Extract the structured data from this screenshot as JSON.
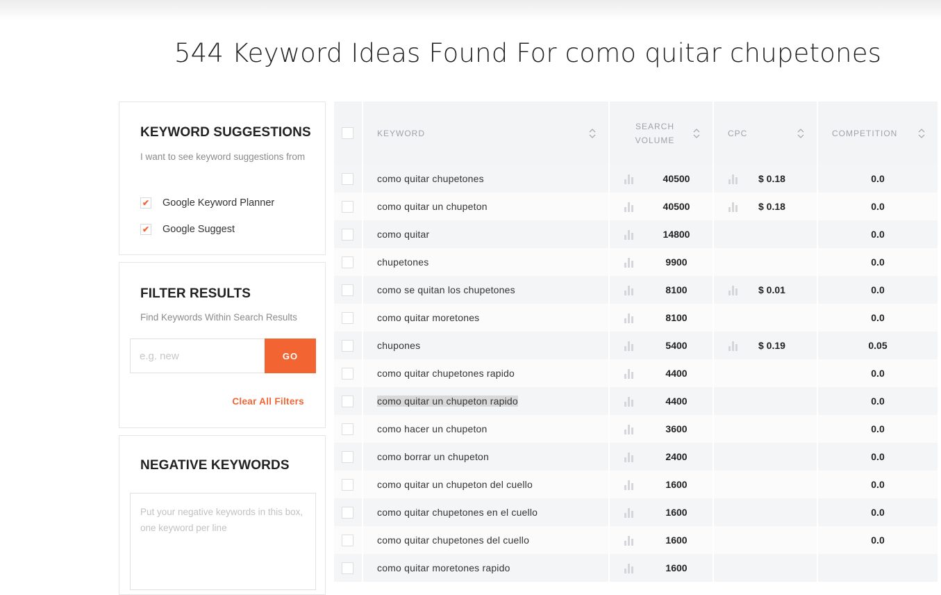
{
  "title": "544 Keyword Ideas Found For como quitar chupetones",
  "suggestions": {
    "heading": "KEYWORD SUGGESTIONS",
    "description": "I want to see keyword suggestions from",
    "options": [
      {
        "label": "Google Keyword Planner",
        "checked": true
      },
      {
        "label": "Google Suggest",
        "checked": true
      }
    ]
  },
  "filter": {
    "heading": "FILTER RESULTS",
    "description": "Find Keywords Within Search Results",
    "placeholder": "e.g. new",
    "go_label": "GO",
    "clear_label": "Clear All Filters"
  },
  "negative": {
    "heading": "NEGATIVE KEYWORDS",
    "placeholder": "Put your negative keywords in this box, one keyword per line"
  },
  "table": {
    "headers": {
      "keyword": "KEYWORD",
      "volume_line1": "SEARCH",
      "volume_line2": "VOLUME",
      "cpc": "CPC",
      "competition": "COMPETITION"
    },
    "rows": [
      {
        "keyword": "como quitar chupetones",
        "volume": "40500",
        "cpc": "$ 0.18",
        "competition": "0.0"
      },
      {
        "keyword": "como quitar un chupeton",
        "volume": "40500",
        "cpc": "$ 0.18",
        "competition": "0.0"
      },
      {
        "keyword": "como quitar",
        "volume": "14800",
        "cpc": "",
        "competition": "0.0"
      },
      {
        "keyword": "chupetones",
        "volume": "9900",
        "cpc": "",
        "competition": "0.0"
      },
      {
        "keyword": "como se quitan los chupetones",
        "volume": "8100",
        "cpc": "$ 0.01",
        "competition": "0.0"
      },
      {
        "keyword": "como quitar moretones",
        "volume": "8100",
        "cpc": "",
        "competition": "0.0"
      },
      {
        "keyword": "chupones",
        "volume": "5400",
        "cpc": "$ 0.19",
        "competition": "0.05"
      },
      {
        "keyword": "como quitar chupetones rapido",
        "volume": "4400",
        "cpc": "",
        "competition": "0.0"
      },
      {
        "keyword": "como quitar un chupeton rapido",
        "volume": "4400",
        "cpc": "",
        "competition": "0.0",
        "highlighted": true
      },
      {
        "keyword": "como hacer un chupeton",
        "volume": "3600",
        "cpc": "",
        "competition": "0.0"
      },
      {
        "keyword": "como borrar un chupeton",
        "volume": "2400",
        "cpc": "",
        "competition": "0.0"
      },
      {
        "keyword": "como quitar un chupeton del cuello",
        "volume": "1600",
        "cpc": "",
        "competition": "0.0"
      },
      {
        "keyword": "como quitar chupetones en el cuello",
        "volume": "1600",
        "cpc": "",
        "competition": "0.0"
      },
      {
        "keyword": "como quitar chupetones del cuello",
        "volume": "1600",
        "cpc": "",
        "competition": "0.0"
      },
      {
        "keyword": "como quitar moretones rapido",
        "volume": "1600",
        "cpc": "",
        "competition": ""
      }
    ]
  },
  "colors": {
    "accent": "#f26532",
    "header_bg": "#f3f4f6",
    "icon_gray": "#d4d6d9"
  },
  "icons": {
    "sort": "sort-arrows-icon",
    "trend": "bar-chart-icon",
    "check": "checkmark-icon"
  }
}
